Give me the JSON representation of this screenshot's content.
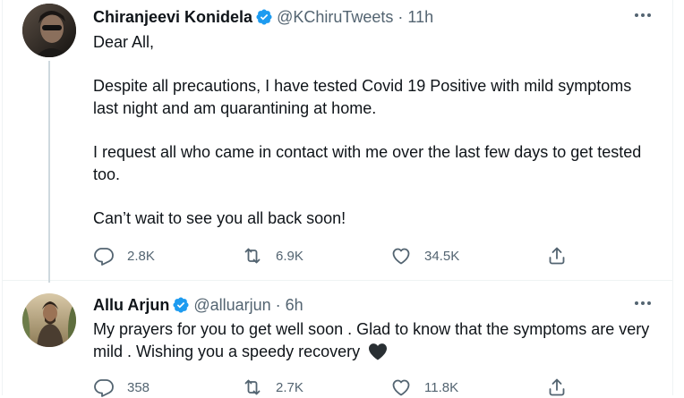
{
  "tweets": [
    {
      "author": {
        "name": "Chiranjeevi Konidela",
        "handle": "@KChiruTweets",
        "time": "11h",
        "verified": true
      },
      "paragraphs": [
        "Dear All,",
        "Despite all precautions, I have tested Covid 19 Positive with mild symptoms last night and am quarantining at home.",
        "I request all who came in contact with me over the last few days to get tested too.",
        "Can’t wait to see you all back soon!"
      ],
      "stats": {
        "replies": "2.8K",
        "retweets": "6.9K",
        "likes": "34.5K"
      }
    },
    {
      "author": {
        "name": "Allu Arjun",
        "handle": "@alluarjun",
        "time": "6h",
        "verified": true
      },
      "text": "My prayers for you to get well soon . Glad to know that the symptoms are very mild . Wishing you a speedy recovery",
      "emoji": "black-heart",
      "stats": {
        "replies": "358",
        "retweets": "2.7K",
        "likes": "11.8K"
      }
    }
  ],
  "separator": "·",
  "colors": {
    "text": "#0f1419",
    "secondary": "#536471",
    "verified": "#1d9bf0",
    "border": "#eff3f4",
    "thread_line": "#cfd9de"
  },
  "icons": [
    "more-icon",
    "reply-icon",
    "retweet-icon",
    "like-icon",
    "share-icon",
    "verified-icon"
  ]
}
